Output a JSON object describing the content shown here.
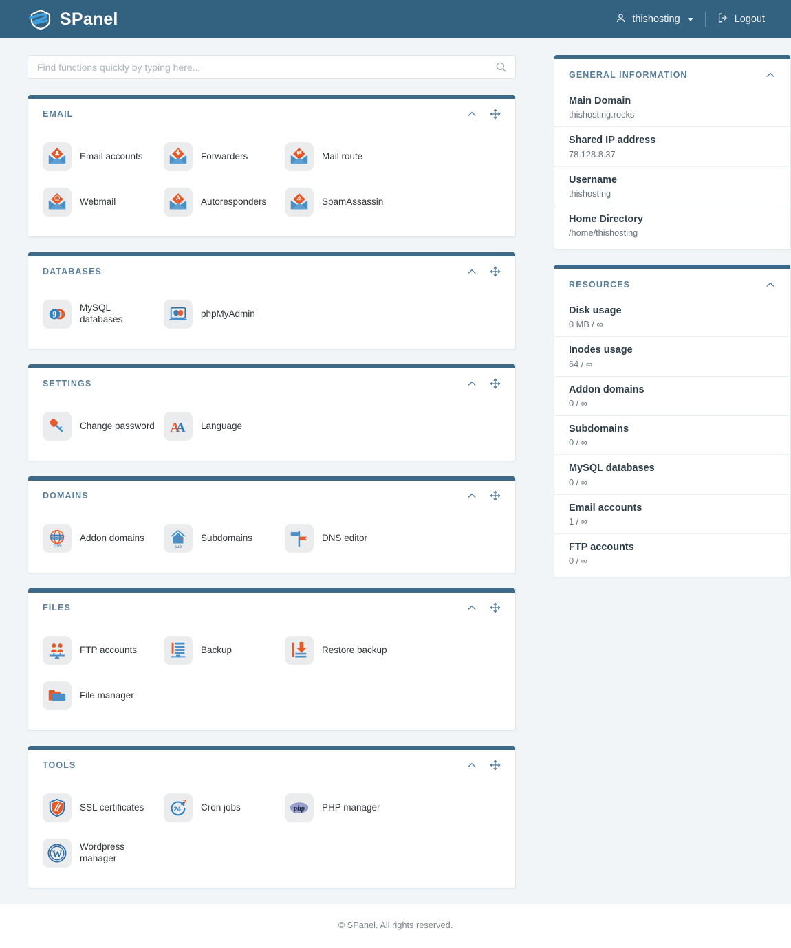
{
  "header": {
    "brand": "SPanel",
    "user": "thishosting",
    "logout": "Logout"
  },
  "search": {
    "placeholder": "Find functions quickly by typing here...",
    "value": ""
  },
  "sections": [
    {
      "title": "EMAIL",
      "items": [
        {
          "label": "Email accounts",
          "icon": "envelope-person-icon"
        },
        {
          "label": "Forwarders",
          "icon": "envelope-forward-icon"
        },
        {
          "label": "Mail route",
          "icon": "envelope-route-icon"
        },
        {
          "label": "Webmail",
          "icon": "envelope-at-icon"
        },
        {
          "label": "Autoresponders",
          "icon": "envelope-a-icon"
        },
        {
          "label": "SpamAssassin",
          "icon": "envelope-spam-icon"
        }
      ]
    },
    {
      "title": "DATABASES",
      "items": [
        {
          "label": "MySQL databases",
          "icon": "mysql-icon"
        },
        {
          "label": "phpMyAdmin",
          "icon": "phpmyadmin-icon"
        }
      ]
    },
    {
      "title": "SETTINGS",
      "items": [
        {
          "label": "Change password",
          "icon": "key-icon"
        },
        {
          "label": "Language",
          "icon": "language-icon"
        }
      ]
    },
    {
      "title": "DOMAINS",
      "items": [
        {
          "label": "Addon domains",
          "icon": "globe-com-icon"
        },
        {
          "label": "Subdomains",
          "icon": "house-sub-icon"
        },
        {
          "label": "DNS editor",
          "icon": "signpost-icon"
        }
      ]
    },
    {
      "title": "FILES",
      "items": [
        {
          "label": "FTP accounts",
          "icon": "ftp-users-icon"
        },
        {
          "label": "Backup",
          "icon": "backup-icon"
        },
        {
          "label": "Restore backup",
          "icon": "restore-backup-icon"
        },
        {
          "label": "File manager",
          "icon": "folder-icon"
        }
      ]
    },
    {
      "title": "TOOLS",
      "items": [
        {
          "label": "SSL certificates",
          "icon": "shield-icon"
        },
        {
          "label": "Cron jobs",
          "icon": "clock-247-icon"
        },
        {
          "label": "PHP manager",
          "icon": "php-icon"
        },
        {
          "label": "Wordpress manager",
          "icon": "wordpress-icon"
        }
      ]
    }
  ],
  "general_information": {
    "title": "GENERAL INFORMATION",
    "rows": [
      {
        "label": "Main Domain",
        "value": "thishosting.rocks"
      },
      {
        "label": "Shared IP address",
        "value": "78.128.8.37"
      },
      {
        "label": "Username",
        "value": "thishosting"
      },
      {
        "label": "Home Directory",
        "value": "/home/thishosting"
      }
    ]
  },
  "resources": {
    "title": "RESOURCES",
    "rows": [
      {
        "label": "Disk usage",
        "value": "0 MB / ∞"
      },
      {
        "label": "Inodes usage",
        "value": "64 / ∞"
      },
      {
        "label": "Addon domains",
        "value": "0 / ∞"
      },
      {
        "label": "Subdomains",
        "value": "0 / ∞"
      },
      {
        "label": "MySQL databases",
        "value": "0 / ∞"
      },
      {
        "label": "Email accounts",
        "value": "1 / ∞"
      },
      {
        "label": "FTP accounts",
        "value": "0 / ∞"
      }
    ]
  },
  "footer": {
    "copyright": "© SPanel. All rights reserved."
  },
  "colors": {
    "header_bg": "#336180",
    "accent_bar": "#3d6a88",
    "section_title": "#5b7f99",
    "icon_orange": "#e8592a",
    "icon_blue": "#4a8fc7",
    "page_bg": "#f1f5f7"
  }
}
